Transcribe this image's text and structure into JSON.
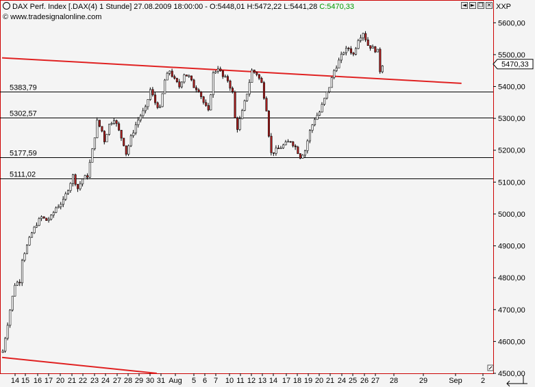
{
  "header": {
    "title_prefix": "DAX Perf. Index [.DAX(4)  1 Stunde] 27.08.2009 18:00:00 - O:5448,01 H:5472,22 L:5441,28 ",
    "close_value": "C:5470,33",
    "source": "www.tradesignalonline.com",
    "axis_code": "XXP",
    "buttons": [
      "◄",
      "►",
      "❐",
      "✕"
    ]
  },
  "colors": {
    "background": "#f4f4f4",
    "frame": "#cc0000",
    "trendline": "#e02020",
    "candle_down": "#b02020",
    "candle_up": "#ffffff",
    "close_text": "#009900"
  },
  "chart_data": {
    "type": "candlestick",
    "ylim": [
      4500,
      5650
    ],
    "ytick_values": [
      4500,
      4600,
      4700,
      4800,
      4900,
      5000,
      5100,
      5200,
      5300,
      5400,
      5500,
      5600
    ],
    "ytick_labels": [
      "4500,00",
      "4600,00",
      "4700,00",
      "4800,00",
      "4900,00",
      "5000,00",
      "5100,00",
      "5200,00",
      "5300,00",
      "5400,00",
      "5500,00",
      "5600,00"
    ],
    "x_labels": [
      "14",
      "15",
      "16",
      "17",
      "20",
      "21",
      "22",
      "23",
      "24",
      "27",
      "28",
      "29",
      "30",
      "31",
      "Aug",
      "5",
      "6",
      "7",
      "10",
      "11",
      "12",
      "13",
      "14",
      "17",
      "18",
      "19",
      "20",
      "21",
      "24",
      "25",
      "26",
      "27",
      "28",
      "29",
      "Sep",
      "2"
    ],
    "last_price": "5470,33",
    "horizontal_lines": [
      {
        "label": "5383,79",
        "value": 5383.79
      },
      {
        "label": "5302,57",
        "value": 5302.57
      },
      {
        "label": "5177,59",
        "value": 5177.59
      },
      {
        "label": "5111,02",
        "value": 5111.02
      }
    ],
    "trendlines": [
      {
        "name": "upper",
        "from": {
          "bar": 0,
          "y": 5490
        },
        "to": {
          "bar": 190,
          "y": 5410
        }
      },
      {
        "name": "lower",
        "from": {
          "bar": 0,
          "y": 4550
        },
        "to": {
          "bar": 64,
          "y": 4500
        }
      }
    ],
    "price_path": [
      [
        0,
        4570
      ],
      [
        3,
        4700
      ],
      [
        5,
        4780
      ],
      [
        7,
        4790
      ],
      [
        8,
        4860
      ],
      [
        12,
        4940
      ],
      [
        14,
        4970
      ],
      [
        16,
        4990
      ],
      [
        18,
        4980
      ],
      [
        20,
        4990
      ],
      [
        22,
        5020
      ],
      [
        25,
        5040
      ],
      [
        27,
        5080
      ],
      [
        29,
        5120
      ],
      [
        31,
        5080
      ],
      [
        33,
        5110
      ],
      [
        35,
        5120
      ],
      [
        37,
        5200
      ],
      [
        39,
        5290
      ],
      [
        41,
        5260
      ],
      [
        42,
        5230
      ],
      [
        44,
        5280
      ],
      [
        46,
        5300
      ],
      [
        48,
        5260
      ],
      [
        50,
        5220
      ],
      [
        51,
        5190
      ],
      [
        53,
        5240
      ],
      [
        55,
        5280
      ],
      [
        57,
        5310
      ],
      [
        59,
        5330
      ],
      [
        61,
        5390
      ],
      [
        63,
        5350
      ],
      [
        65,
        5330
      ],
      [
        67,
        5420
      ],
      [
        69,
        5450
      ],
      [
        71,
        5420
      ],
      [
        73,
        5400
      ],
      [
        75,
        5440
      ],
      [
        77,
        5430
      ],
      [
        79,
        5400
      ],
      [
        81,
        5390
      ],
      [
        83,
        5350
      ],
      [
        85,
        5320
      ],
      [
        87,
        5440
      ],
      [
        89,
        5460
      ],
      [
        91,
        5430
      ],
      [
        93,
        5420
      ],
      [
        95,
        5380
      ],
      [
        96,
        5300
      ],
      [
        97,
        5270
      ],
      [
        99,
        5320
      ],
      [
        101,
        5380
      ],
      [
        103,
        5450
      ],
      [
        105,
        5440
      ],
      [
        107,
        5410
      ],
      [
        109,
        5330
      ],
      [
        110,
        5250
      ],
      [
        111,
        5190
      ],
      [
        113,
        5200
      ],
      [
        115,
        5210
      ],
      [
        117,
        5220
      ],
      [
        119,
        5230
      ],
      [
        121,
        5210
      ],
      [
        123,
        5180
      ],
      [
        125,
        5200
      ],
      [
        127,
        5260
      ],
      [
        129,
        5300
      ],
      [
        131,
        5320
      ],
      [
        133,
        5360
      ],
      [
        135,
        5400
      ],
      [
        137,
        5450
      ],
      [
        139,
        5480
      ],
      [
        141,
        5510
      ],
      [
        143,
        5520
      ],
      [
        145,
        5500
      ],
      [
        147,
        5550
      ],
      [
        149,
        5570
      ],
      [
        151,
        5530
      ],
      [
        153,
        5520
      ],
      [
        155,
        5510
      ],
      [
        156,
        5450
      ],
      [
        157,
        5470
      ]
    ]
  }
}
